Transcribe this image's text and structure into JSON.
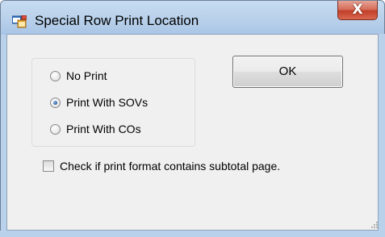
{
  "window": {
    "title": "Special Row Print Location",
    "close_glyph": "X",
    "icon": "app-window-icon"
  },
  "print_location": {
    "options": [
      {
        "label": "No Print",
        "checked": false
      },
      {
        "label": "Print With SOVs",
        "checked": true
      },
      {
        "label": "Print With COs",
        "checked": false
      }
    ]
  },
  "ok_button": {
    "label": "OK"
  },
  "subtotal_checkbox": {
    "label": "Check if print format contains subtotal page.",
    "checked": false
  },
  "colors": {
    "frame": "#b9d1ea",
    "client": "#f0f0f0",
    "close_button": "#c2402b",
    "radio_dot": "#2b5f9e"
  }
}
